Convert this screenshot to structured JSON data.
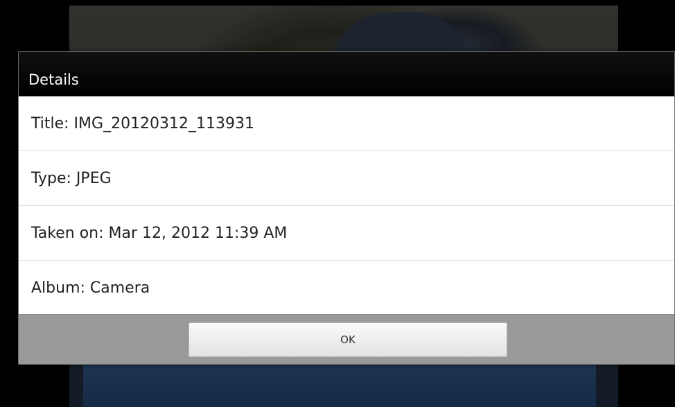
{
  "dialog": {
    "title": "Details",
    "rows": [
      {
        "text": "Title: IMG_20120312_113931"
      },
      {
        "text": "Type: JPEG"
      },
      {
        "text": "Taken on: Mar 12, 2012 11:39 AM"
      },
      {
        "text": "Album: Camera"
      }
    ],
    "ok_label": "OK"
  }
}
